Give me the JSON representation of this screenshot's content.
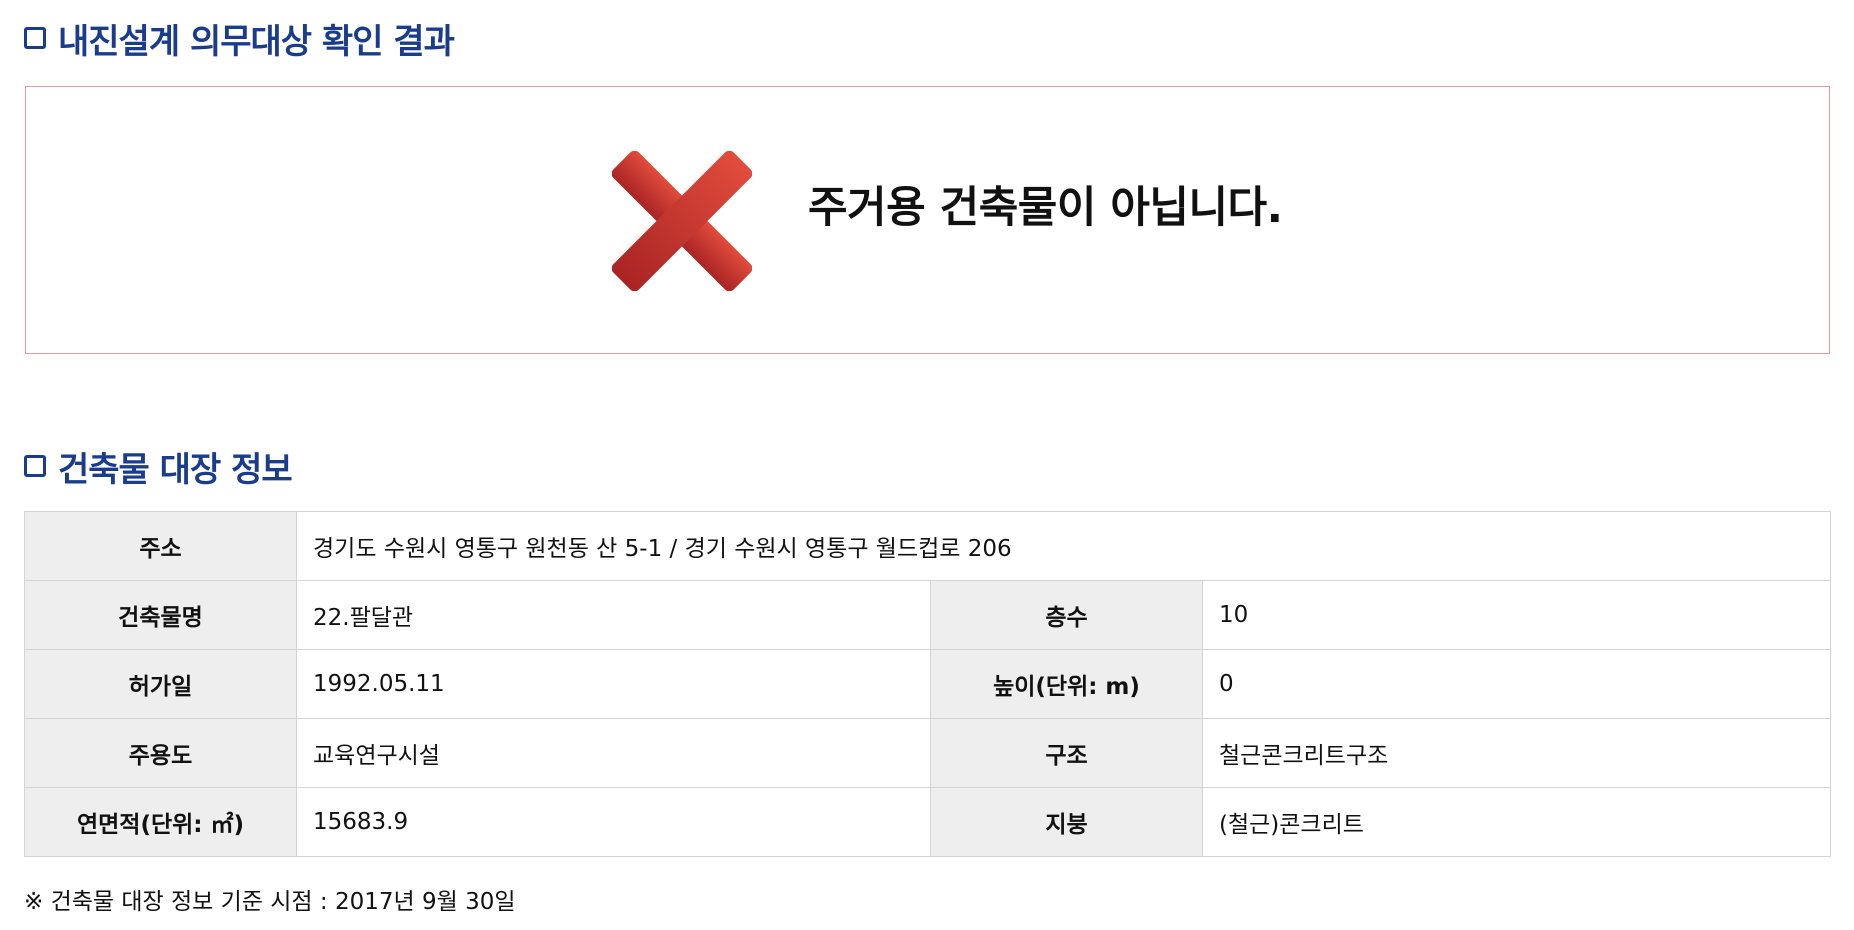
{
  "sections": {
    "result_title": "내진설계 의무대상 확인 결과",
    "registry_title": "건축물 대장 정보"
  },
  "result": {
    "icon": "red-x-icon",
    "message": "주거용 건축물이 아닙니다.",
    "colors": {
      "x_top": "#e24c3c",
      "x_bottom": "#a82424",
      "border": "#e39a9a"
    }
  },
  "registry": {
    "address_label": "주소",
    "address_value": "경기도 수원시 영통구 원천동 산 5-1 / 경기 수원시 영통구 월드컵로 206",
    "rows": [
      {
        "label1": "건축물명",
        "value1": "22.팔달관",
        "label2": "층수",
        "value2": "10"
      },
      {
        "label1": "허가일",
        "value1": "1992.05.11",
        "label2": "높이(단위: m)",
        "value2": "0"
      },
      {
        "label1": "주용도",
        "value1": "교육연구시설",
        "label2": "구조",
        "value2": "철근콘크리트구조"
      },
      {
        "label1": "연면적(단위: ㎡)",
        "value1": "15683.9",
        "label2": "지붕",
        "value2": "(철근)콘크리트"
      }
    ]
  },
  "footnote": "※ 건축물 대장 정보 기준 시점 : 2017년 9월 30일",
  "theme": {
    "title_color": "#1a3c8c",
    "header_bg": "#eeeeee",
    "border": "#d4d4d4"
  }
}
